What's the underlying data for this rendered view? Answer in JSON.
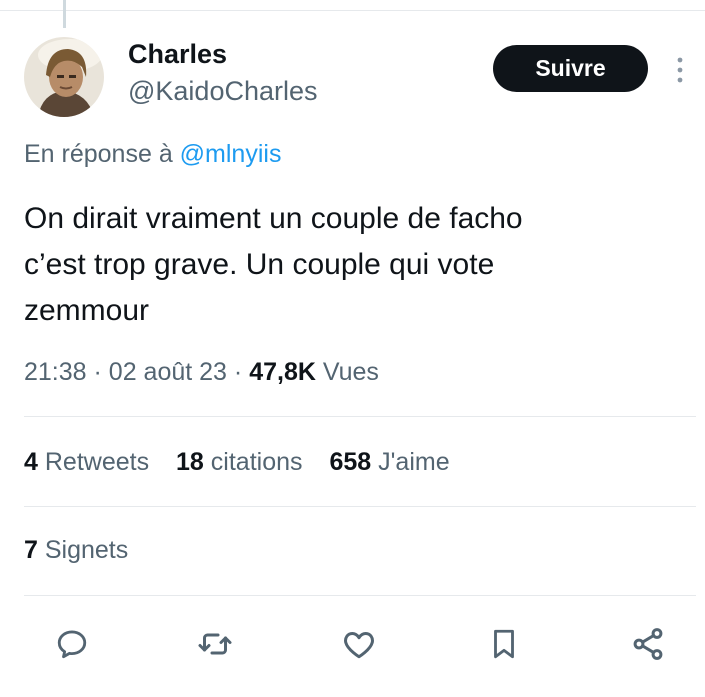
{
  "author": {
    "name": "Charles",
    "handle": "@KaidoCharles"
  },
  "follow_label": "Suivre",
  "reply_to": {
    "prefix": "En réponse à",
    "mention": "@mlnyiis"
  },
  "tweet": {
    "text": "On dirait vraiment un couple de facho\nc’est trop grave. Un couple qui vote\nzemmour"
  },
  "meta": {
    "time": "21:38",
    "date": "02 août 23",
    "views_count": "47,8K",
    "views_label": "Vues"
  },
  "stats": {
    "retweets_count": "4",
    "retweets_label": "Retweets",
    "quotes_count": "18",
    "quotes_label": "citations",
    "likes_count": "658",
    "likes_label": "J'aime",
    "bookmarks_count": "7",
    "bookmarks_label": "Signets"
  },
  "actions": [
    "reply-icon",
    "retweet-icon",
    "like-icon",
    "bookmark-icon",
    "share-icon"
  ],
  "colors": {
    "text": "#0f1419",
    "secondary": "#536471",
    "link": "#1d9bf0",
    "button": "#0f1419",
    "divider": "#e6e9ec"
  }
}
